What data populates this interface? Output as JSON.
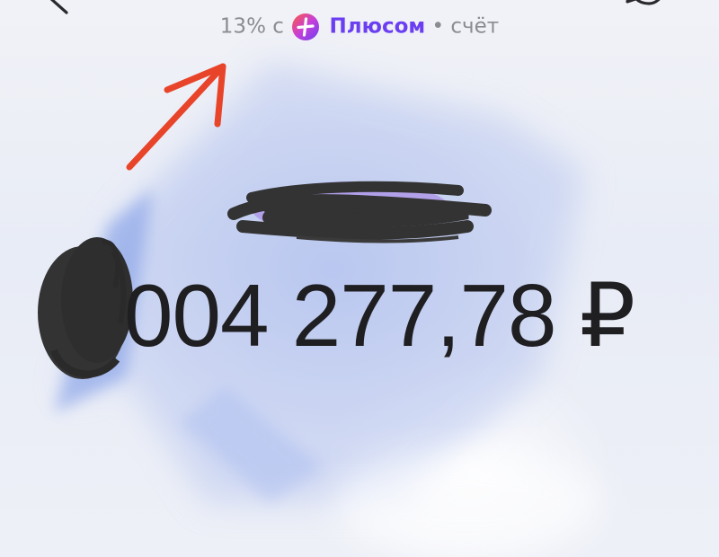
{
  "header": {
    "cashback_percent": "13% с",
    "plus_brand": "Плюсом",
    "separator": "•",
    "account_label": "счёт"
  },
  "balance": {
    "amount_visible": "004 277,78 ₽"
  },
  "colors": {
    "plus_brand": "#6b3ff1",
    "annotation_arrow": "#e8442a",
    "balance_text": "#1f1f22",
    "secondary_text": "#8b8b90"
  },
  "icons": {
    "back": "back-chevron-icon",
    "chat": "chat-bubble-icon",
    "plus": "plus-logo-icon"
  }
}
